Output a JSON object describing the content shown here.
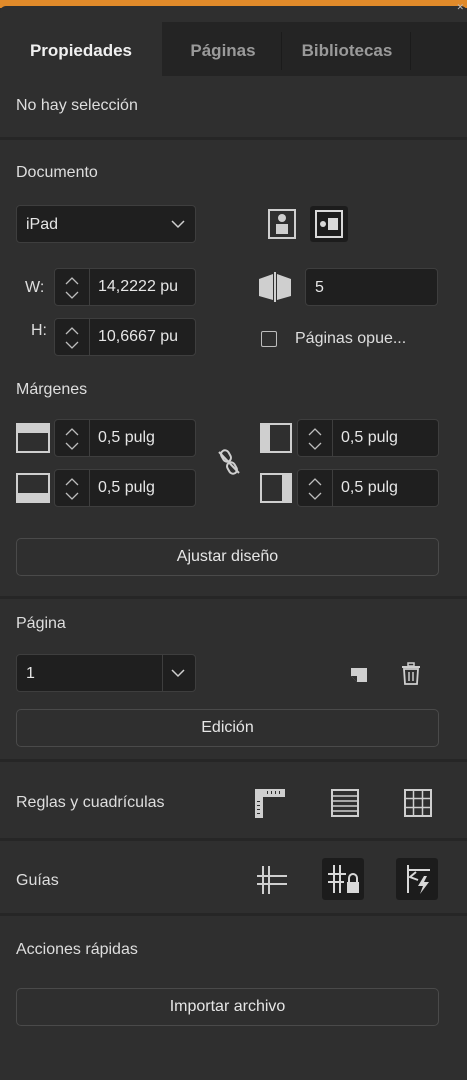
{
  "tabs": [
    {
      "label": "Propiedades"
    },
    {
      "label": "Páginas"
    },
    {
      "label": "Bibliotecas"
    }
  ],
  "selection_status": "No hay selección",
  "documento": {
    "title": "Documento",
    "preset": "iPad",
    "width": "14,2222 pu",
    "height": "10,6667 pu",
    "width_label": "W:",
    "height_label": "H:",
    "pages_count": "5",
    "facing_pages_label": "Páginas opue..."
  },
  "margenes": {
    "title": "Márgenes",
    "top": "0,5 pulg",
    "bottom": "0,5 pulg",
    "inside": "0,5 pulg",
    "outside": "0,5 pulg"
  },
  "ajustar_label": "Ajustar diseño",
  "pagina": {
    "title": "Página",
    "current": "1",
    "edicion_label": "Edición"
  },
  "reglas_label": "Reglas y cuadrículas",
  "guias_label": "Guías",
  "acciones": {
    "title": "Acciones rápidas",
    "import_label": "Importar archivo"
  },
  "colors": {
    "panel_bg": "#2f2f2f",
    "tabbar_bg": "#242424",
    "field_bg": "#1f1f1f",
    "accent_strip": "#e08a2a"
  },
  "icons": [
    "portrait-icon",
    "landscape-icon",
    "pages-icon",
    "link-icon",
    "margin-top-icon",
    "margin-bottom-icon",
    "margin-inside-icon",
    "margin-outside-icon",
    "new-page-icon",
    "trash-icon",
    "rulers-icon",
    "baseline-grid-icon",
    "document-grid-icon",
    "guides-icon",
    "lock-guides-icon",
    "smart-guides-icon"
  ]
}
